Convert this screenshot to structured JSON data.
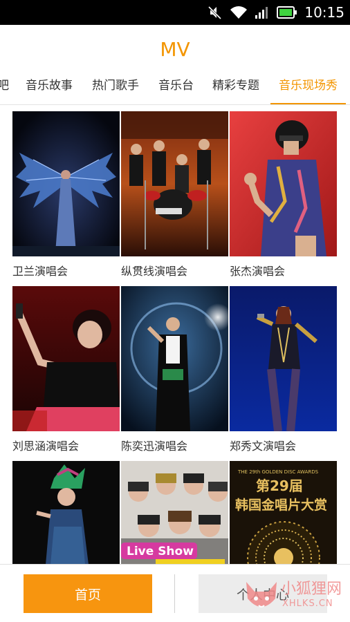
{
  "status_bar": {
    "time": "10:15",
    "icons": [
      "mute-icon",
      "wifi-icon",
      "signal-icon",
      "battery-icon"
    ]
  },
  "header": {
    "title": "MV"
  },
  "tabs": [
    {
      "label": "吧",
      "active": false
    },
    {
      "label": "音乐故事",
      "active": false
    },
    {
      "label": "热门歌手",
      "active": false
    },
    {
      "label": "音乐台",
      "active": false
    },
    {
      "label": "精彩专题",
      "active": false
    },
    {
      "label": "音乐现场秀",
      "active": true
    }
  ],
  "grid": {
    "items": [
      {
        "title": "卫兰演唱会"
      },
      {
        "title": "纵贯线演唱会"
      },
      {
        "title": "张杰演唱会"
      },
      {
        "title": "刘思涵演唱会"
      },
      {
        "title": "陈奕迅演唱会"
      },
      {
        "title": "郑秀文演唱会"
      },
      {
        "title": ""
      },
      {
        "title": ""
      },
      {
        "title": ""
      }
    ],
    "poster_text": {
      "live_show": "Live Show",
      "golden_disc_header": "THE 29th GOLDEN DISC AWARDS",
      "golden_disc_line1": "第29届",
      "golden_disc_line2": "韩国金唱片大赏"
    }
  },
  "bottom_nav": {
    "home_label": "首页",
    "profile_label": "个人中心"
  },
  "watermark": {
    "text_cn": "小狐狸网",
    "text_en": "XHLKS.CN"
  },
  "colors": {
    "accent": "#f39500",
    "status_bar_bg": "#000000",
    "battery": "#3fd23f"
  }
}
